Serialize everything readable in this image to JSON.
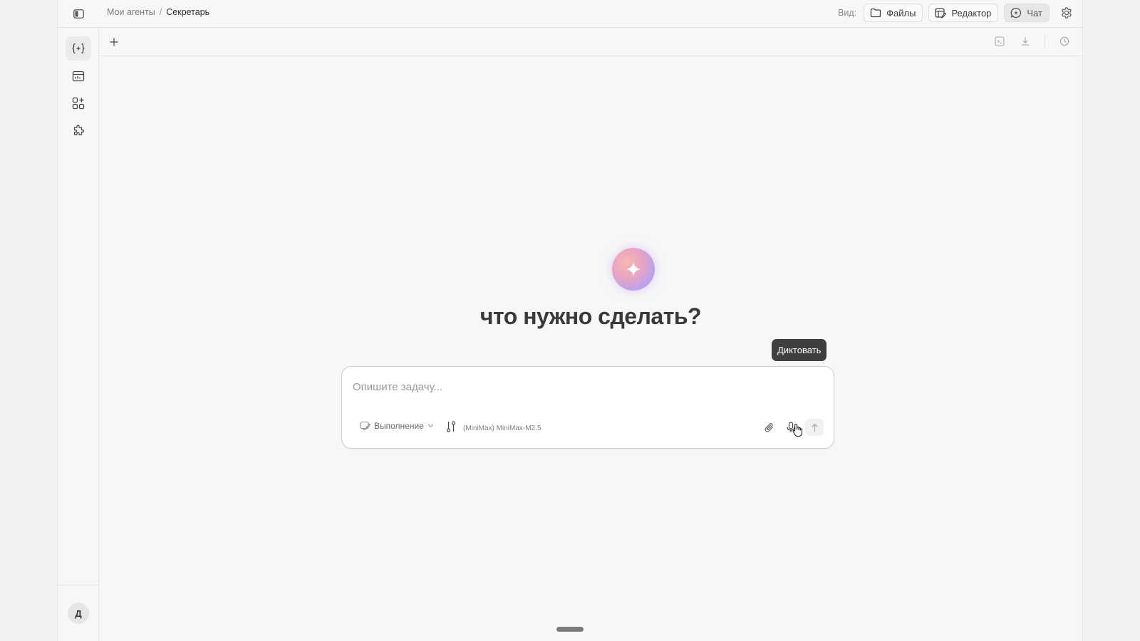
{
  "breadcrumb": {
    "parent": "Мои агенты",
    "separator": "/",
    "current": "Секретарь"
  },
  "view": {
    "label": "Вид:",
    "buttons": [
      {
        "label": "Файлы",
        "icon": "folder-icon"
      },
      {
        "label": "Редактор",
        "icon": "editor-icon"
      },
      {
        "label": "Чат",
        "icon": "chat-icon",
        "active": true
      }
    ]
  },
  "rail": {
    "items": [
      {
        "icon": "agent-icon",
        "active": true
      },
      {
        "icon": "dashboard-icon"
      },
      {
        "icon": "apps-add-icon"
      },
      {
        "icon": "puzzle-icon"
      }
    ],
    "avatar_initial": "Д"
  },
  "hero": {
    "headline": "что нужно сделать?"
  },
  "composer": {
    "placeholder": "Опишите задачу...",
    "mode_label": "Выполнение",
    "model_label": "(MiniMax) MiniMax-M2.5",
    "tooltip": "Диктовать"
  },
  "colors": {
    "accent_orb": "#b7a2ef",
    "tooltip_bg": "#3f3f3f"
  }
}
